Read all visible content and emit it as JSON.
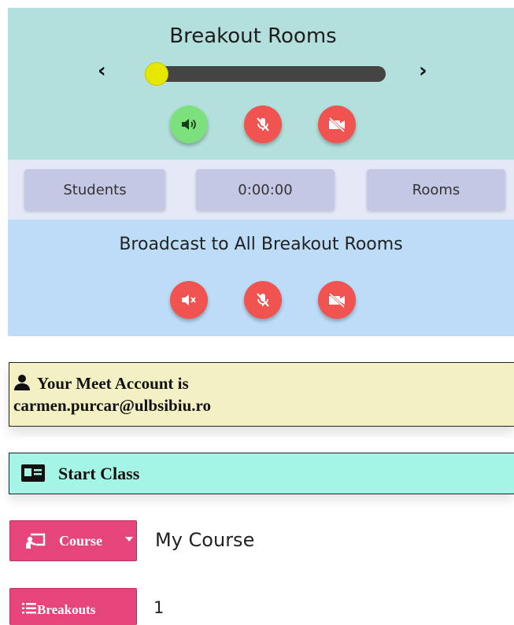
{
  "breakout": {
    "title": "Breakout Rooms",
    "slider_value": 0,
    "buttons": {
      "audio_on": "speaker-on-icon",
      "mic_muted": "mic-off-icon",
      "video_off": "video-off-icon"
    }
  },
  "controls": {
    "students_label": "Students",
    "timer": "0:00:00",
    "rooms_label": "Rooms"
  },
  "broadcast": {
    "title": "Broadcast to All Breakout Rooms",
    "buttons": [
      "speaker-muted-icon",
      "mic-off-icon",
      "video-off-icon"
    ]
  },
  "account": {
    "line1": "Your Meet Account is",
    "email": "carmen.purcar@ulbsibiu.ro"
  },
  "start_class": {
    "label": "Start Class"
  },
  "course": {
    "label": "Course",
    "value": "My Course"
  },
  "breakouts": {
    "label": "Breakouts",
    "value": "1"
  },
  "colors": {
    "panel_top": "#b3e0dc",
    "broadcast_panel": "#bcdcf8",
    "button_red": "#f05350",
    "button_green": "#7ce07c",
    "slider_thumb": "#e6e600",
    "account_bg": "#f3f0c4",
    "start_class_bg": "#a5f5e6",
    "dropdown_pink": "#e6457b"
  }
}
